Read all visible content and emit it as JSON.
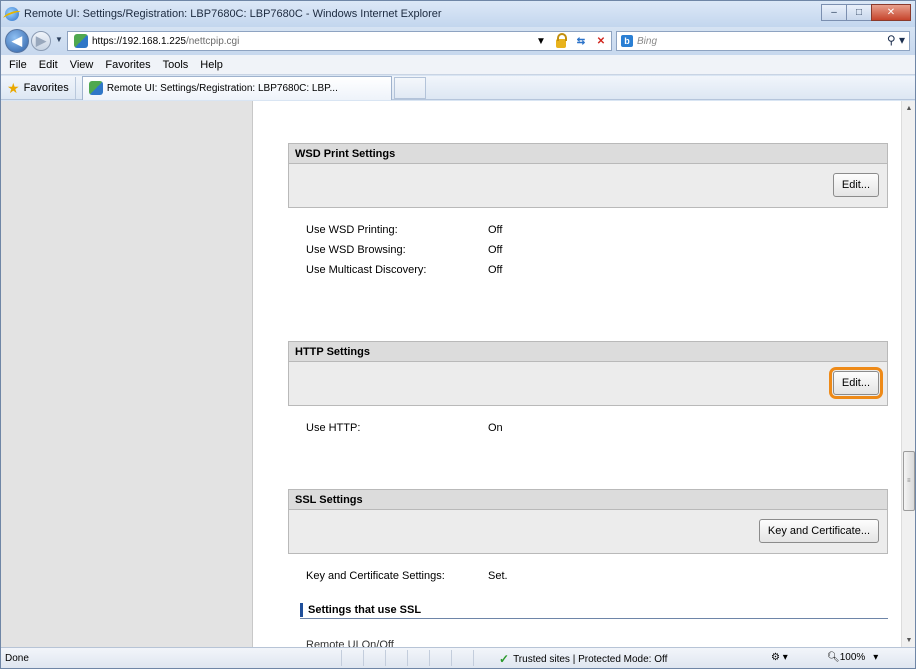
{
  "window": {
    "title": "Remote UI: Settings/Registration: LBP7680C: LBP7680C - Windows Internet Explorer",
    "minimize": "–",
    "maximize": "□",
    "close": "✕"
  },
  "address": {
    "url_host": "https://192.168.1.225",
    "url_path": "/nettcpip.cgi"
  },
  "search": {
    "engine": "b",
    "placeholder": "Bing"
  },
  "menu": [
    "File",
    "Edit",
    "View",
    "Favorites",
    "Tools",
    "Help"
  ],
  "favorites": {
    "label": "Favorites",
    "tab_title": "Remote UI: Settings/Registration: LBP7680C: LBP..."
  },
  "sections": {
    "wsd": {
      "title": "WSD Print Settings",
      "edit_label": "Edit...",
      "rows": [
        {
          "key": "Use WSD Printing:",
          "value": "Off"
        },
        {
          "key": "Use WSD Browsing:",
          "value": "Off"
        },
        {
          "key": "Use Multicast Discovery:",
          "value": "Off"
        }
      ]
    },
    "http": {
      "title": "HTTP Settings",
      "edit_label": "Edit...",
      "rows": [
        {
          "key": "Use HTTP:",
          "value": "On"
        }
      ]
    },
    "ssl": {
      "title": "SSL Settings",
      "button_label": "Key and Certificate...",
      "rows": [
        {
          "key": "Key and Certificate Settings:",
          "value": "Set."
        }
      ],
      "subheading": "Settings that use SSL",
      "cut_item": "Remote UI On/Off"
    }
  },
  "status": {
    "left": "Done",
    "zone": "Trusted sites | Protected Mode: Off",
    "zoom": "100%"
  }
}
